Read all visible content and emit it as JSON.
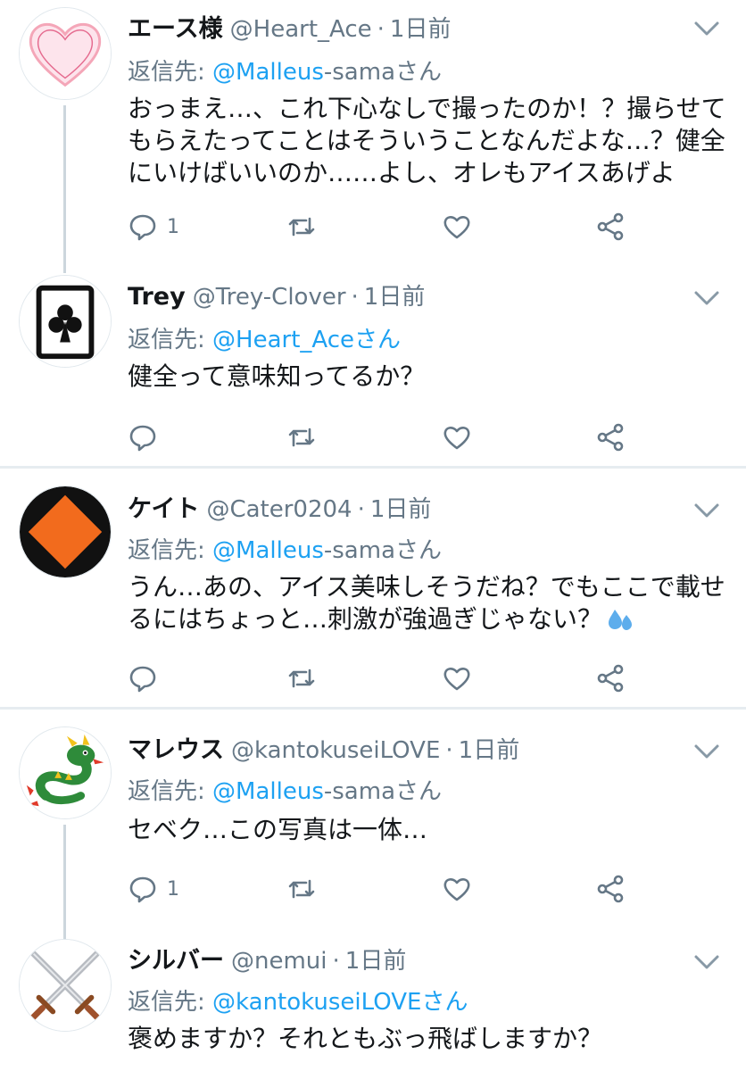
{
  "tweets": [
    {
      "name": "エース様",
      "handle": "@Heart_Ace",
      "sep": "·",
      "time": "1日前",
      "reply_prefix": "返信先: ",
      "reply_mention": "@Malleus",
      "reply_suffix": "-samaさん",
      "text": "おっまえ…、これ下心なしで撮ったのか！？撮らせてもらえたってことはそういうことなんだよな…？健全にいけばいいのか……よし、オレもアイスあげよ",
      "reply_count": "1",
      "avatar_icon": "heart-icon"
    },
    {
      "name": "Trey",
      "handle": "@Trey-Clover",
      "sep": "·",
      "time": "1日前",
      "reply_prefix": "返信先: ",
      "reply_mention": "@Heart_Ace",
      "reply_suffix": "さん",
      "text": "健全って意味知ってるか？",
      "reply_count": "",
      "avatar_icon": "club-card-icon"
    },
    {
      "name": "ケイト",
      "handle": "@Cater0204",
      "sep": "·",
      "time": "1日前",
      "reply_prefix": "返信先: ",
      "reply_mention": "@Malleus",
      "reply_suffix": "-samaさん",
      "text": "うん…あの、アイス美味しそうだね？でもここで載せるにはちょっと…刺激が強過ぎじゃない？",
      "reply_count": "",
      "avatar_icon": "diamond-icon"
    },
    {
      "name": "マレウス",
      "handle": "@kantokuseiLOVE",
      "sep": "·",
      "time": "1日前",
      "reply_prefix": "返信先: ",
      "reply_mention": "@Malleus",
      "reply_suffix": "-samaさん",
      "text": "セベク…この写真は一体…",
      "reply_count": "1",
      "avatar_icon": "dragon-icon"
    },
    {
      "name": "シルバー",
      "handle": "@nemui",
      "sep": "·",
      "time": "1日前",
      "reply_prefix": "返信先: ",
      "reply_mention": "@kantokuseiLOVE",
      "reply_suffix": "さん",
      "text": "褒めますか？それともぶっ飛ばしますか？",
      "reply_count": "",
      "avatar_icon": "crossed-swords-icon"
    }
  ],
  "colors": {
    "link": "#1da1f2",
    "muted": "#657786",
    "divider": "#e6ecf0",
    "thread": "#ccd6dd",
    "orange": "#f26b1d",
    "heart_pink": "#f4a6b8"
  }
}
